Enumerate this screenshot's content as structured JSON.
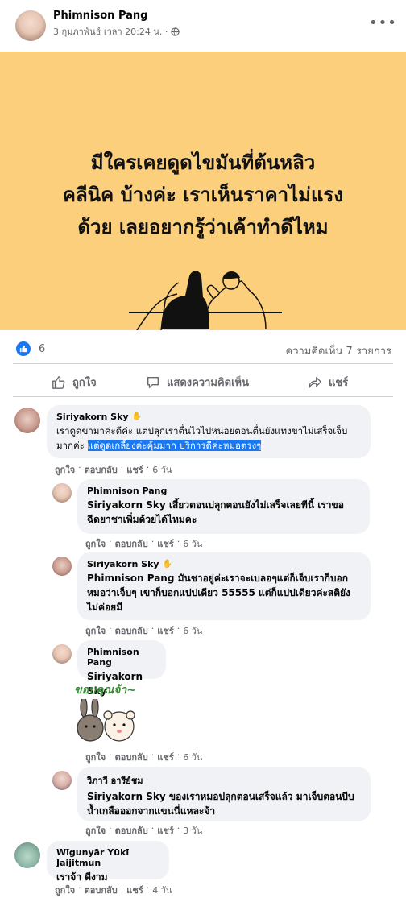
{
  "post": {
    "author": "Phimnison Pang",
    "timestamp": "3 กุมภาพันธ์ เวลา 20:24 น. ·",
    "privacy_icon": "globe-icon",
    "more_icon": "more-dots-icon",
    "text_lines": [
      "มีใครเคยดูดไขมันที่ต้นหลิว",
      "คลีนิค บ้างค่ะ เราเห็นราคาไม่แรง",
      "ด้วย เลยอยากรู้ว่าเค้าทำดีไหม"
    ],
    "background_color": "#fccf7c"
  },
  "stats": {
    "reaction_count": "6",
    "comment_count": "ความคิดเห็น 7 รายการ"
  },
  "actions": {
    "like": "ถูกใจ",
    "comment": "แสดงความคิดเห็น",
    "share": "แชร์"
  },
  "comments": [
    {
      "author": "Siriyakorn Sky",
      "text_plain": "เราดูดขามาค่ะดีค่ะ แต่ปลุกเราตื่นไวไปหน่อยตอนตื่นยังแทงขาไม่เสร็จเจ็บมากค่ะ ",
      "text_highlight": "แต่ดูดเกลี้ยงค่ะคุ้มมาก บริการดีค่ะหมอตรงๆ",
      "like": "ถูกใจ",
      "reply": "ตอบกลับ",
      "share": "แชร์",
      "time": "6 วัน"
    },
    {
      "author": "Phimnison Pang",
      "text": "Siriyakorn Sky เสี้ยวตอนปลุกตอนยังไม่เสร็จเลยทีนี้ เราขอฉีดยาชาเพิ่มด้วยได้ไหมคะ",
      "like": "ถูกใจ",
      "reply": "ตอบกลับ",
      "share": "แชร์",
      "time": "6 วัน"
    },
    {
      "author": "Siriyakorn Sky",
      "text": "Phimnison Pang มันชาอยู่ค่ะเราจะเบลอๆแต่ก็เจ็บเราก็บอกหมอว่าเจ็บๆ เขาก็บอกแปปเดียว 55555 แต่ก็แปปเดียวค่ะสติยังไม่ค่อยมี",
      "like": "ถูกใจ",
      "reply": "ตอบกลับ",
      "share": "แชร์",
      "time": "6 วัน"
    },
    {
      "author": "Phimnison Pang",
      "text": "Siriyakorn Sky",
      "sticker_text": "ขอบคุณจ้า~",
      "like": "ถูกใจ",
      "reply": "ตอบกลับ",
      "share": "แชร์",
      "time": "6 วัน"
    },
    {
      "author": "วิภาวี อารีย์ชม",
      "text": "Siriyakorn Sky ของเราหมอปลุกตอนเสร็จแล้ว มาเจ็บตอนบีบน้ำเกลือออกจากแขนนี่แหละจ้า",
      "like": "ถูกใจ",
      "reply": "ตอบกลับ",
      "share": "แชร์",
      "time": "3 วัน"
    },
    {
      "author": "Wīgunyār Yūkī Jaijitmun",
      "text": "เราจ้า ดีงาม",
      "like": "ถูกใจ",
      "reply": "ตอบกลับ",
      "share": "แชร์",
      "time": "4 วัน"
    }
  ]
}
